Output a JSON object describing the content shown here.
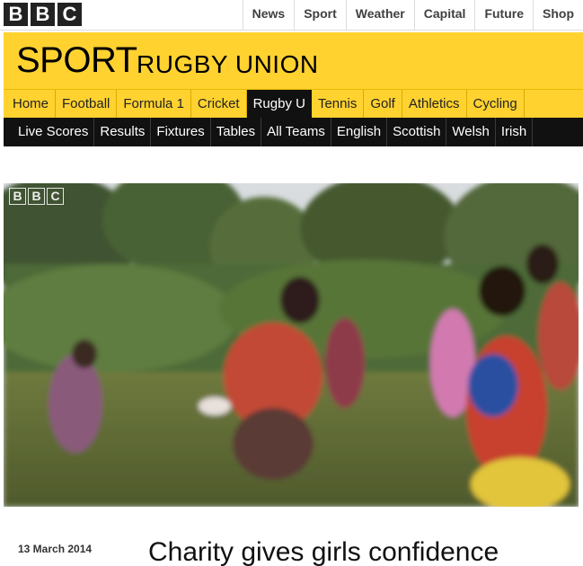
{
  "header": {
    "logo": [
      "B",
      "B",
      "C"
    ],
    "nav": [
      "News",
      "Sport",
      "Weather",
      "Capital",
      "Future",
      "Shop"
    ]
  },
  "masthead": {
    "title": "SPORT",
    "section": "RUGBY UNION"
  },
  "primary_nav": {
    "items": [
      "Home",
      "Football",
      "Formula 1",
      "Cricket",
      "Rugby U",
      "Tennis",
      "Golf",
      "Athletics",
      "Cycling"
    ],
    "active": "Rugby U"
  },
  "secondary_nav": {
    "items": [
      "Live Scores",
      "Results",
      "Fixtures",
      "Tables",
      "All Teams",
      "English",
      "Scottish",
      "Welsh",
      "Irish"
    ]
  },
  "video": {
    "watermark": [
      "B",
      "B",
      "C"
    ]
  },
  "article": {
    "date": "13 March 2014",
    "headline": "Charity gives girls confidence"
  },
  "colors": {
    "sport_yellow": "#ffd230",
    "nav_black": "#111111"
  }
}
